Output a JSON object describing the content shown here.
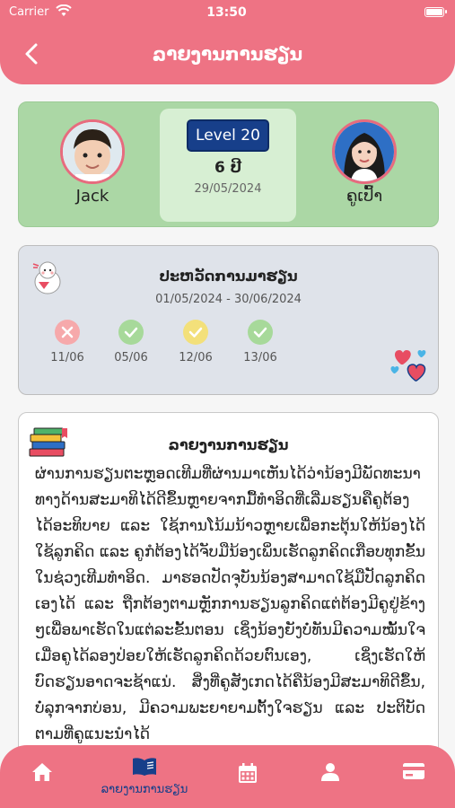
{
  "status": {
    "carrier": "Carrier",
    "time": "13:50"
  },
  "header": {
    "title": "ລາຍງານການຮຽນ"
  },
  "profile": {
    "student_name": "Jack",
    "teacher_name": "ຄູເປົ້າ",
    "level": "Level 20",
    "age": "6 ປີ",
    "date": "29/05/2024"
  },
  "history": {
    "title": "ປະຫວັດການມາຮຽນ",
    "range": "01/05/2024 - 30/06/2024",
    "days": [
      {
        "date": "11/06",
        "status": "absent",
        "color": "#f6a9ab"
      },
      {
        "date": "05/06",
        "status": "present",
        "color": "#a7d99a"
      },
      {
        "date": "12/06",
        "status": "late",
        "color": "#f3e07a"
      },
      {
        "date": "13/06",
        "status": "present",
        "color": "#a7d99a"
      }
    ]
  },
  "report": {
    "title": "ລາຍງານການຮຽນ",
    "body": "ຜ່ານການຮຽນຕະຫຼອດເທີມທີ່ຜ່ານມາເຫັນໄດ້ວ່ານ້ອງມີພັດທະນາທາງດ້ານສະມາທິໄດ້ດີຂຶ້ນຫຼາຍຈາກມື້ທຳອິດທີ່ເລີ່ມຮຽນຄືຄູຕ້ອງໄດ້ອະທິບາຍ ແລະ ໃຊ້ການໂນ້ມນ້າວຫຼາຍເພື່ອກະຕຸ້ນໃຫ້ນ້ອງໄດ້ໃຊ້ລູກຄິດ ແລະ ຄູກໍຕ້ອງໄດ້ຈັບມືນ້ອງເພິ່ນເຮັດລູກຄິດເກືອບທຸກຂັ້ນໃນຊ່ວງເທີມທຳອິດ. ມາຮອດປັດຈຸບັນນ້ອງສາມາດໃຊ້ມືປັດລູກຄິດເອງໄດ້ ແລະ ຖືກຕ້ອງຕາມຫຼັກການຮຽນລູກຄິດແຕ່ຕ້ອງມີຄູຢູ່ຂ້າງໆເພື່ອພາເຮັດໃນແຕ່ລະຂັ້ນຕອນ ເຊິ່ງນ້ອງຍັງບໍ່ທັນມີຄວາມໝັ້ນໃຈເມື່ອຄູໄດ້ລອງປ່ອຍໃຫ້ເຮັດລູກຄິດດ້ວຍຕົນເອງ, ເຊິ່ງເຮັດໃຫ້ບົດຮຽນອາດຈະຊ້າແນ່. ສິ່ງທີ່ຄູສັງເກດໄດ້ຄືນ້ອງມີສະມາທິດີຂຶ້ນ, ບໍ່ລຸກຈາກບ່ອນ, ມີຄວາມພະຍາຍາມຕັ້ງໃຈຮຽນ ແລະ ປະຕິບັດຕາມທີ່ຄູແນະນຳໄດ້"
  },
  "tabs": [
    {
      "name": "home",
      "icon": "home-icon"
    },
    {
      "name": "report",
      "icon": "book-icon",
      "label": "ລາຍງານການຮຽນ"
    },
    {
      "name": "calendar",
      "icon": "calendar-icon"
    },
    {
      "name": "profile",
      "icon": "user-icon"
    },
    {
      "name": "payment",
      "icon": "card-icon"
    }
  ],
  "colors": {
    "accent": "#ee7384",
    "navy": "#173f8a",
    "green_card": "#abd7a5"
  }
}
